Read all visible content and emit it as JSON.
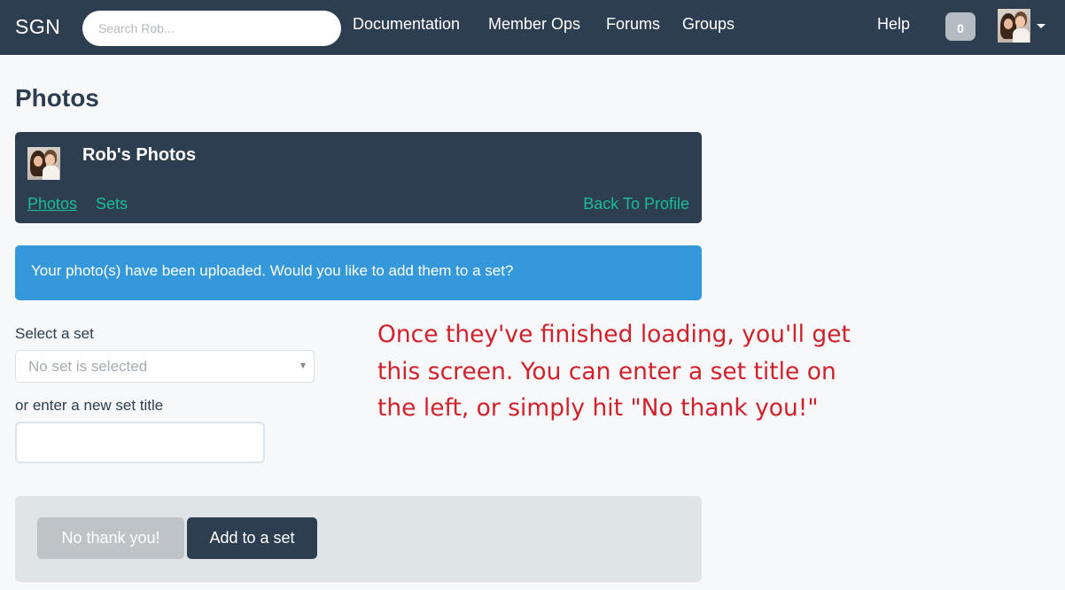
{
  "navbar": {
    "brand": "SGN",
    "search_placeholder": "Search Rob...",
    "links": [
      "Documentation",
      "Member Ops",
      "Forums",
      "Groups"
    ],
    "help": "Help",
    "notification_count": "0"
  },
  "page": {
    "title": "Photos"
  },
  "photos_card": {
    "title": "Rob's Photos",
    "tabs": [
      "Photos",
      "Sets"
    ],
    "back_link": "Back To Profile"
  },
  "alert": {
    "message": "Your photo(s) have been uploaded. Would you like to add them to a set?"
  },
  "form": {
    "select_label": "Select a set",
    "select_value": "No set is selected",
    "new_set_label": "or enter a new set title",
    "new_set_value": ""
  },
  "annotation": {
    "text": "Once they've finished loading, you'll get this screen. You can enter a set title on the left, or simply hit \"No thank you!\""
  },
  "actions": {
    "no_thanks_label": "No thank you!",
    "add_label": "Add to a set"
  },
  "colors": {
    "navbar": "#2c3e50",
    "accent": "#1abc9c",
    "alert": "#3498db",
    "annotation": "#d1212b"
  }
}
